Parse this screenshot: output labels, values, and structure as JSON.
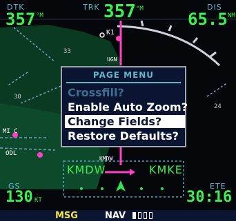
{
  "top": {
    "left": {
      "label": "DTK",
      "value": "357",
      "unit": "°M"
    },
    "center": {
      "label": "TRK",
      "value": "357",
      "unit": "°M"
    },
    "right": {
      "label": "DIS",
      "value": "65.5",
      "unit": "NM"
    }
  },
  "map": {
    "labels": {
      "k1": "K1",
      "ugn": "UGN",
      "r33": "33",
      "r30": "30",
      "r24": "24",
      "odl": "ODL",
      "kmdw_small": "KMDW",
      "mic": "MI C"
    },
    "colors": {
      "range_ring": "#c8cdd6",
      "route": "#ff40c0",
      "land": "#0e4a2c"
    }
  },
  "menu": {
    "title": "PAGE MENU",
    "items": [
      {
        "label": "Crossfill?",
        "state": "disabled"
      },
      {
        "label": "Enable Auto Zoom?",
        "state": "normal"
      },
      {
        "label": "Change Fields?",
        "state": "selected"
      },
      {
        "label": "Restore Defaults?",
        "state": "normal"
      }
    ]
  },
  "route": {
    "from": "KMDW",
    "to": "KMKE"
  },
  "bottom": {
    "left": {
      "label": "GS",
      "value": "130",
      "unit": "KT"
    },
    "right": {
      "label": "ETE",
      "value": "30:16"
    }
  },
  "statusbar": {
    "msg": "MSG",
    "nav": "NAV"
  }
}
